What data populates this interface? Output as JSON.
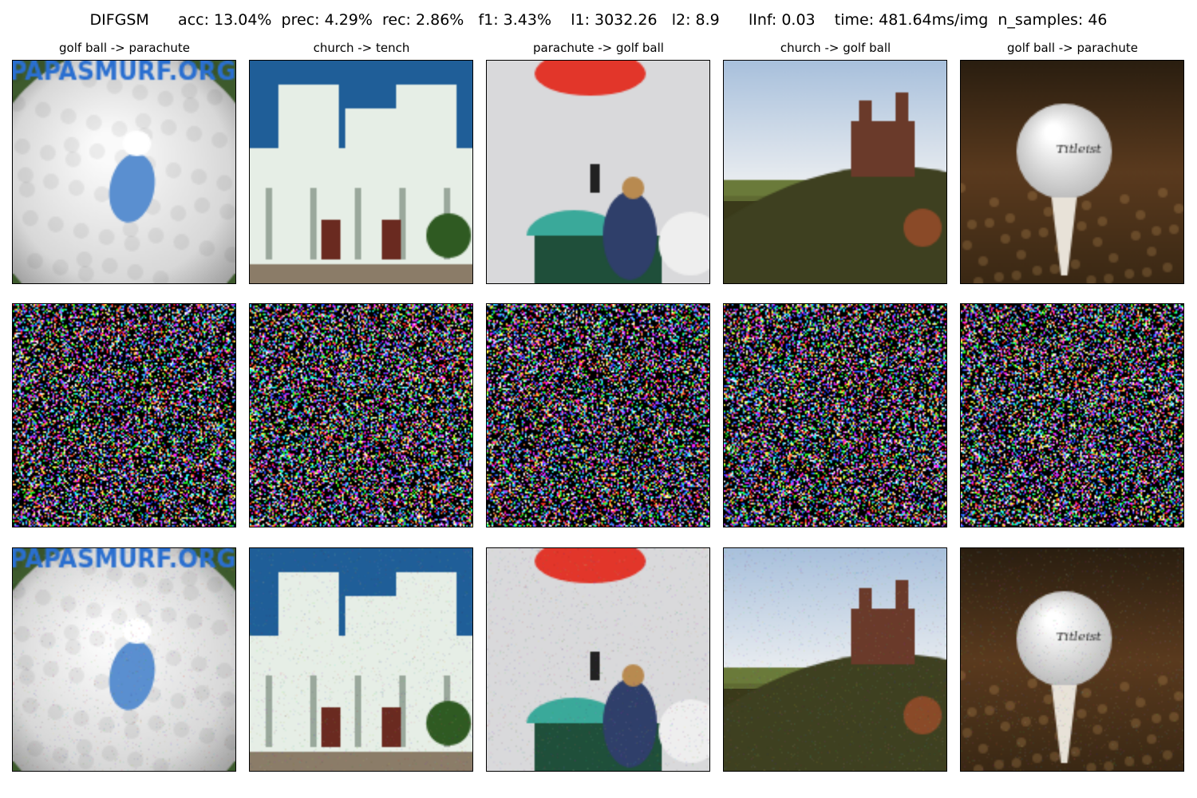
{
  "suptitle": "DIFGSM      acc: 13.04%  prec: 4.29%  rec: 2.86%   f1: 3.43%    l1: 3032.26   l2: 8.9      lInf: 0.03    time: 481.64ms/img  n_samples: 46",
  "columns": [
    {
      "title": "golf ball -> parachute",
      "scene": "golf-ball-smurf"
    },
    {
      "title": "church -> tench",
      "scene": "church"
    },
    {
      "title": "parachute -> golf ball",
      "scene": "parachute"
    },
    {
      "title": "church -> golf ball",
      "scene": "church-hill"
    },
    {
      "title": "golf ball -> parachute",
      "scene": "golf-ball-tee"
    }
  ],
  "rows": [
    "original",
    "perturbation",
    "adversarial"
  ],
  "logo_text": "PAPASMURF.ORG"
}
